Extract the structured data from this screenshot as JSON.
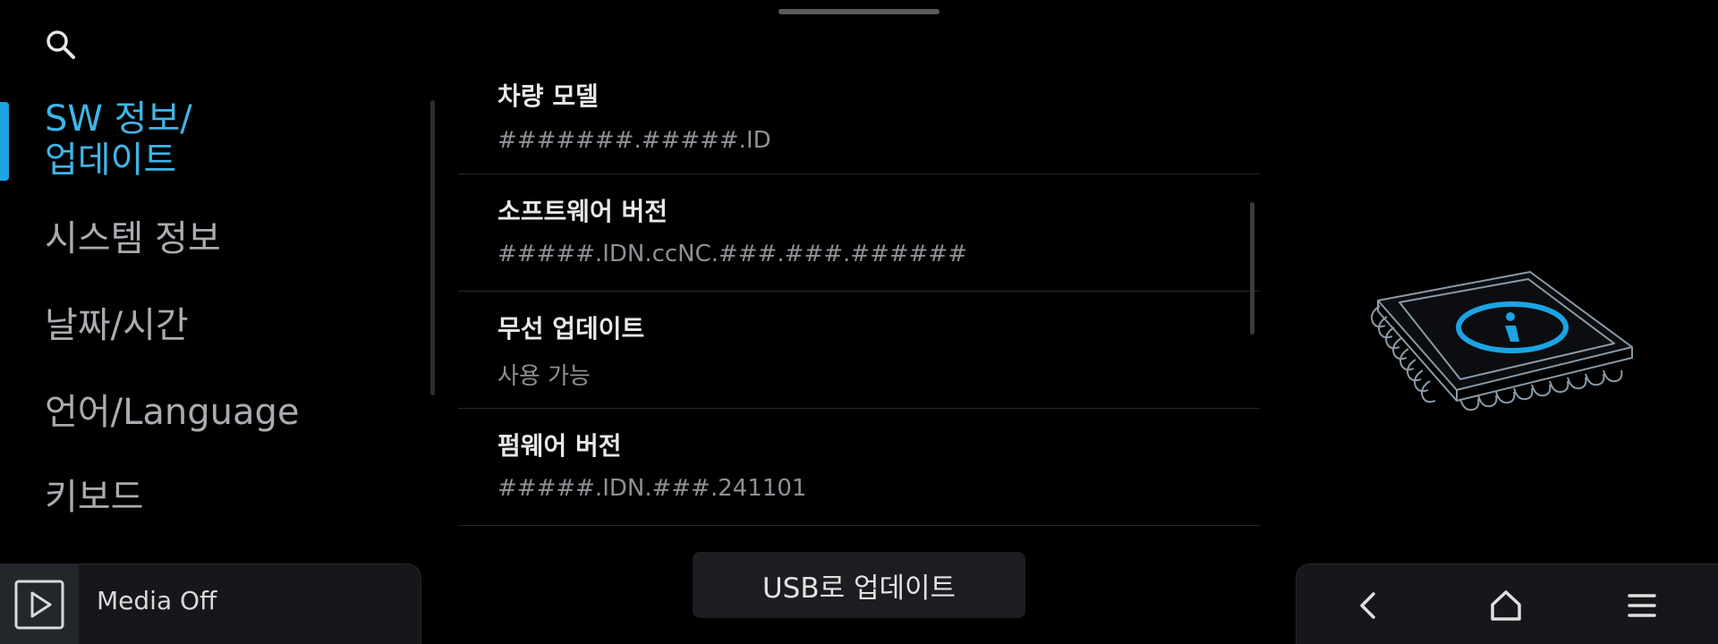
{
  "search": {
    "icon": "search-icon"
  },
  "sidebar": {
    "items": [
      {
        "label_line1": "SW 정보/",
        "label_line2": "업데이트",
        "active": true
      },
      {
        "label": "시스템 정보"
      },
      {
        "label": "날짜/시간"
      },
      {
        "label": "언어/Language"
      },
      {
        "label": "키보드"
      }
    ]
  },
  "info_list": {
    "rows": [
      {
        "title": "차량 모델",
        "value": "#######.#####.ID"
      },
      {
        "title": "소프트웨어 버전",
        "value": "#####.IDN.ccNC.###.###.######"
      },
      {
        "title": "무선 업데이트",
        "value": "사용 가능"
      },
      {
        "title": "펌웨어 버전",
        "value": "#####.IDN.###.241101"
      }
    ]
  },
  "usb_update": {
    "label": "USB로 업데이트"
  },
  "media": {
    "icon": "play-icon",
    "label": "Media Off"
  },
  "nav": {
    "back_icon": "back-icon",
    "home_icon": "home-icon",
    "menu_icon": "menu-icon"
  },
  "colors": {
    "accent": "#1ba4e4",
    "active_text": "#3fb5e8",
    "inactive_text": "#a9acb1",
    "value_text": "#8e9196",
    "background": "#000000",
    "panel": "#15171a"
  }
}
